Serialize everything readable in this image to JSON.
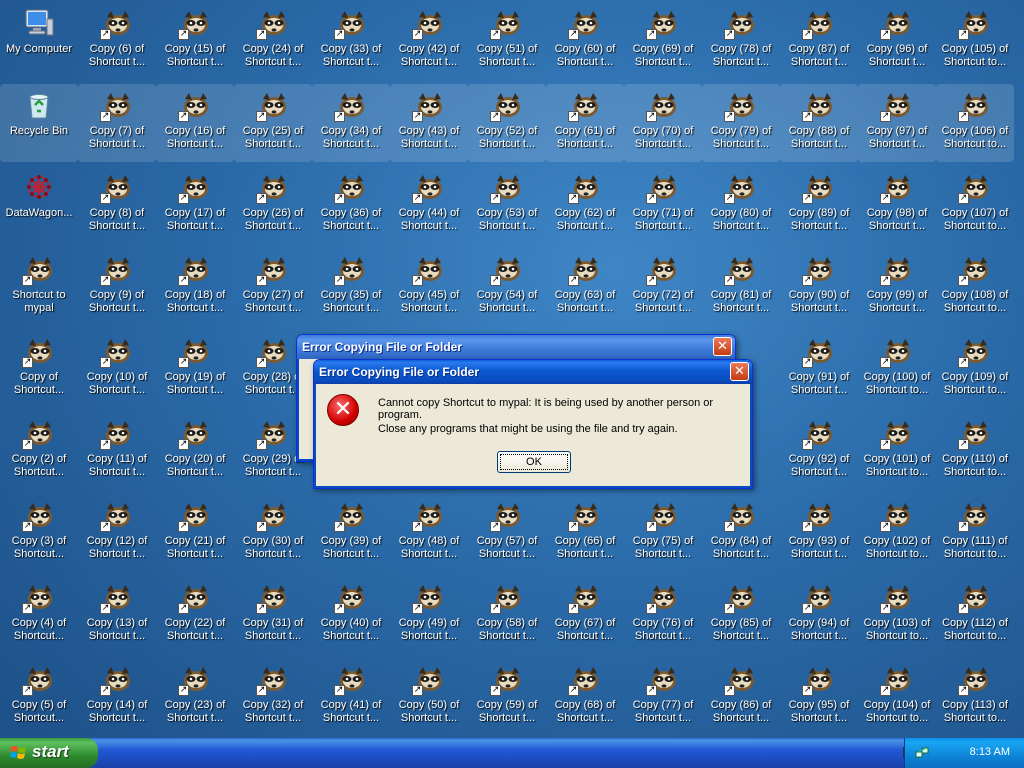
{
  "desktop": {
    "system_icons": [
      {
        "label": "My Computer",
        "icon": "my-computer-icon"
      },
      {
        "label": "Recycle Bin",
        "icon": "recycle-bin-icon"
      },
      {
        "label": "DataWagon...",
        "icon": "datawagon-icon"
      },
      {
        "label": "Shortcut to\nmypal",
        "icon": "mypal-raccoon-icon"
      },
      {
        "label": "Copy of\nShortcut...",
        "icon": "mypal-raccoon-icon"
      },
      {
        "label": "Copy (2) of\nShortcut...",
        "icon": "mypal-raccoon-icon"
      },
      {
        "label": "Copy (3) of\nShortcut...",
        "icon": "mypal-raccoon-icon"
      },
      {
        "label": "Copy (4) of\nShortcut...",
        "icon": "mypal-raccoon-icon"
      },
      {
        "label": "Copy (5) of\nShortcut...",
        "icon": "mypal-raccoon-icon"
      }
    ],
    "copy_columns": [
      [
        6,
        7,
        8,
        9,
        10,
        11,
        12,
        13,
        14
      ],
      [
        15,
        16,
        17,
        18,
        19,
        20,
        21,
        22,
        23
      ],
      [
        24,
        25,
        26,
        27,
        28,
        29,
        30,
        31,
        32
      ],
      [
        33,
        34,
        36,
        35,
        null,
        null,
        39,
        40,
        41
      ],
      [
        42,
        43,
        44,
        45,
        null,
        null,
        48,
        49,
        50
      ],
      [
        51,
        52,
        53,
        54,
        null,
        null,
        57,
        58,
        59
      ],
      [
        60,
        61,
        62,
        63,
        null,
        null,
        66,
        67,
        68
      ],
      [
        69,
        70,
        71,
        72,
        null,
        null,
        75,
        76,
        77
      ],
      [
        78,
        79,
        80,
        81,
        null,
        null,
        84,
        85,
        86
      ],
      [
        87,
        88,
        89,
        90,
        91,
        92,
        93,
        94,
        95
      ],
      [
        96,
        97,
        98,
        99,
        100,
        101,
        102,
        103,
        104
      ],
      [
        105,
        106,
        107,
        108,
        109,
        110,
        111,
        112,
        113
      ]
    ],
    "label_prefix": "Copy",
    "label_suffix_short": "Shortcut t...",
    "label_suffix_long": "Shortcut to...",
    "hidden_partial_labels": {
      "col3_row4": "Copy (28)",
      "col3_row5": "Copy (29)"
    }
  },
  "dialog_back": {
    "title": "Error Copying File or Folder",
    "close_glyph": "✕"
  },
  "dialog_front": {
    "title": "Error Copying File or Folder",
    "close_glyph": "✕",
    "message_line1": "Cannot copy Shortcut to mypal: It is being used by another person or program.",
    "message_line2": "Close any programs that might be using the file and try again.",
    "ok_label": "OK",
    "icon": "error-icon",
    "icon_glyph": "✕"
  },
  "taskbar": {
    "start_label": "start",
    "clock": "8:13 AM",
    "tray_icons": [
      "keyboard-icon",
      "network-icon"
    ]
  },
  "colors": {
    "desktop": "#2a6aa8",
    "titlebar": "#0a4cc0",
    "taskbar": "#2157d7",
    "start_button": "#2f8a2f",
    "dialog_face": "#ece9d8"
  }
}
